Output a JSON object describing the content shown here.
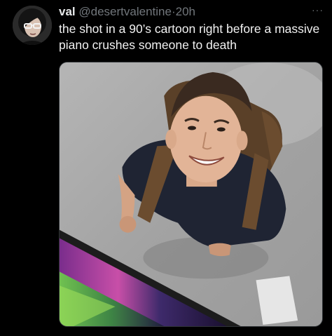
{
  "tweet": {
    "display_name": "val",
    "handle": "@desertvalentine",
    "separator": "·",
    "time": "20h",
    "text": "the shot in a 90’s cartoon right before a massive piano crushes someone to death",
    "more_icon": "ellipsis-icon"
  },
  "colors": {
    "background": "#000000",
    "text": "#e7e9ea",
    "muted": "#71767b"
  }
}
